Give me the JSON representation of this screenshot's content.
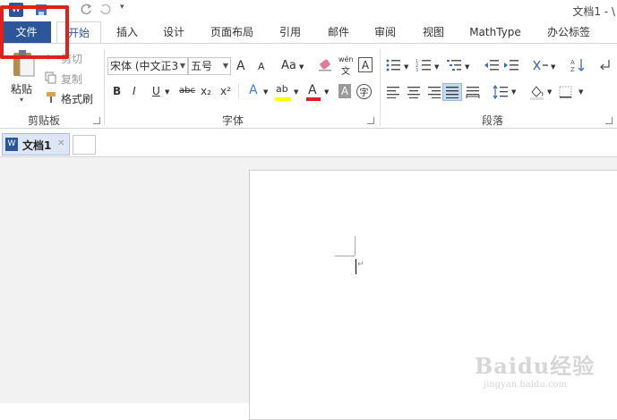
{
  "title_bar": {
    "doc_title": "文档1 - \\",
    "quick_access": [
      "word-app-icon",
      "save-icon",
      "undo-icon",
      "redo-icon",
      "customize-icon"
    ]
  },
  "tabs": [
    {
      "label": "文件",
      "active": false
    },
    {
      "label": "开始",
      "active": true
    },
    {
      "label": "插入"
    },
    {
      "label": "设计"
    },
    {
      "label": "页面布局"
    },
    {
      "label": "引用"
    },
    {
      "label": "邮件"
    },
    {
      "label": "审阅"
    },
    {
      "label": "视图"
    },
    {
      "label": "MathType"
    },
    {
      "label": "办公标签"
    }
  ],
  "clipboard": {
    "paste_label": "粘贴",
    "cut_label": "剪切",
    "copy_label": "复制",
    "format_painter_label": "格式刷",
    "group_label": "剪贴板"
  },
  "font": {
    "font_name": "宋体 (中文正3",
    "font_size": "五号",
    "grow_label": "A",
    "shrink_label": "A",
    "case_label": "Aa",
    "phonetic_label": "wén",
    "bold": "B",
    "italic": "I",
    "underline": "U",
    "strike": "abc",
    "subscript": "x₂",
    "superscript": "x²",
    "effects": "A",
    "highlight": "ab",
    "font_color": "A",
    "char_shading": "A",
    "enclose": "字",
    "group_label": "字体"
  },
  "paragraph": {
    "group_label": "段落"
  },
  "doc_tabs": {
    "tab_label": "文档1",
    "close": "✕"
  },
  "watermark": {
    "brand": "Baidu经验",
    "url": "jingyan.baidu.com"
  },
  "colors": {
    "file_tab": "#2b579a",
    "highlight": "#e0201a",
    "highlight_yellow": "#ffff00",
    "font_red": "#e02020"
  }
}
